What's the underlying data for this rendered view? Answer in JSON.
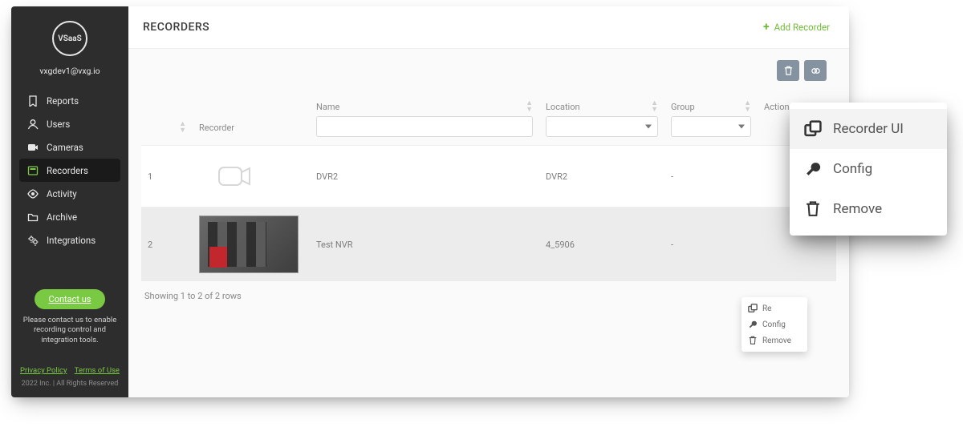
{
  "brand": {
    "logo_text": "VSaaS",
    "account_email": "vxgdev1@vxg.io"
  },
  "sidebar": {
    "items": [
      {
        "icon": "bookmark",
        "label": "Reports",
        "selected": false
      },
      {
        "icon": "user",
        "label": "Users",
        "selected": false
      },
      {
        "icon": "camera",
        "label": "Cameras",
        "selected": false
      },
      {
        "icon": "recorder",
        "label": "Recorders",
        "selected": true
      },
      {
        "icon": "eye",
        "label": "Activity",
        "selected": false
      },
      {
        "icon": "folder",
        "label": "Archive",
        "selected": false
      },
      {
        "icon": "gears",
        "label": "Integrations",
        "selected": false
      }
    ],
    "contact": {
      "button_label": "Contact us",
      "note": "Please contact us to enable recording control and integration tools."
    },
    "legal": {
      "privacy": "Privacy Policy",
      "terms": "Terms of Use",
      "copyright": "2022 Inc. | All Rights Reserved"
    }
  },
  "page": {
    "title": "RECORDERS",
    "add_button": "Add Recorder"
  },
  "toolbar": {
    "delete_tooltip": "Delete",
    "link_tooltip": "Link"
  },
  "table": {
    "columns": {
      "recorder": "Recorder",
      "name": "Name",
      "location": "Location",
      "group": "Group",
      "action": "Action"
    },
    "filters": {
      "name": "",
      "location": "",
      "group": ""
    },
    "rows": [
      {
        "index": "1",
        "thumb": "placeholder",
        "name": "DVR2",
        "location": "DVR2",
        "group": "-"
      },
      {
        "index": "2",
        "thumb": "image",
        "name": "Test NVR",
        "location": "4_5906",
        "group": "-"
      }
    ],
    "footer": "Showing 1 to 2 of 2 rows"
  },
  "inline_menu": {
    "items": [
      {
        "icon": "recorder-ui",
        "label_short": "Re",
        "label": "Recorder UI"
      },
      {
        "icon": "wrench",
        "label": "Config"
      },
      {
        "icon": "trash",
        "label": "Remove"
      }
    ]
  },
  "big_menu": {
    "items": [
      {
        "icon": "recorder-ui",
        "label": "Recorder UI",
        "selected": true
      },
      {
        "icon": "wrench",
        "label": "Config",
        "selected": false
      },
      {
        "icon": "trash",
        "label": "Remove",
        "selected": false
      }
    ]
  }
}
